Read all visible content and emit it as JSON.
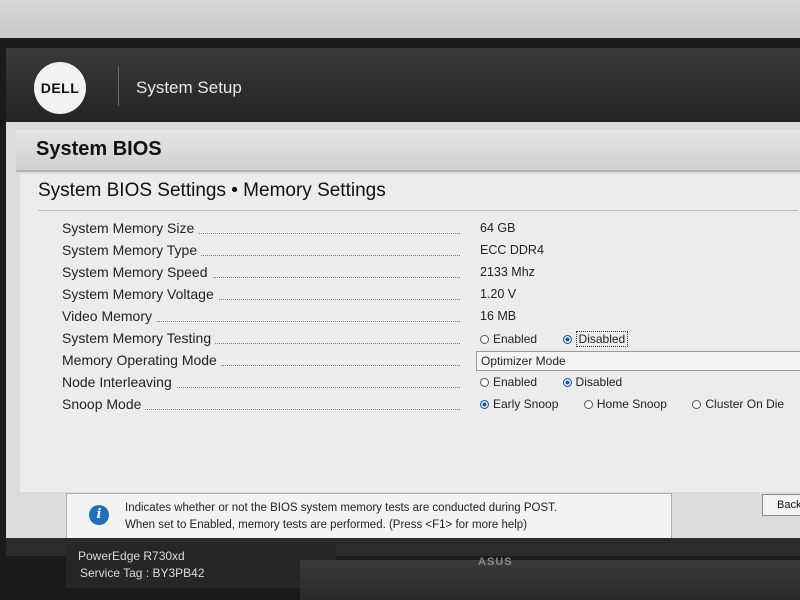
{
  "app": {
    "brand": "DELL",
    "title": "System Setup"
  },
  "page": {
    "title": "System BIOS"
  },
  "section": {
    "title": "System BIOS Settings • Memory Settings"
  },
  "settings": [
    {
      "label": "System Memory Size",
      "value": "64 GB"
    },
    {
      "label": "System Memory Type",
      "value": "ECC DDR4"
    },
    {
      "label": "System Memory Speed",
      "value": "2133 Mhz"
    },
    {
      "label": "System Memory Voltage",
      "value": "1.20 V"
    },
    {
      "label": "Video Memory",
      "value": "16 MB"
    },
    {
      "label": "System Memory Testing",
      "options": [
        "Enabled",
        "Disabled"
      ],
      "selected": "Disabled"
    },
    {
      "label": "Memory Operating Mode",
      "value": "Optimizer Mode"
    },
    {
      "label": "Node Interleaving",
      "options": [
        "Enabled",
        "Disabled"
      ],
      "selected": "Disabled"
    },
    {
      "label": "Snoop Mode",
      "options": [
        "Early Snoop",
        "Home Snoop",
        "Cluster On Die"
      ],
      "selected": "Early Snoop"
    }
  ],
  "help": {
    "line1": "Indicates whether or not the BIOS system memory tests are conducted during POST.",
    "line2": "When set to Enabled, memory tests are performed. (Press <F1> for more help)"
  },
  "buttons": {
    "back": "Back"
  },
  "footer": {
    "model": "PowerEdge R730xd",
    "service_tag": "Service Tag : BY3PB42"
  },
  "monitor": {
    "brand": "ASUS"
  },
  "colors": {
    "accent": "#1a4f9c",
    "info": "#1f6fbf",
    "titlebar": "#2b2b2b"
  }
}
